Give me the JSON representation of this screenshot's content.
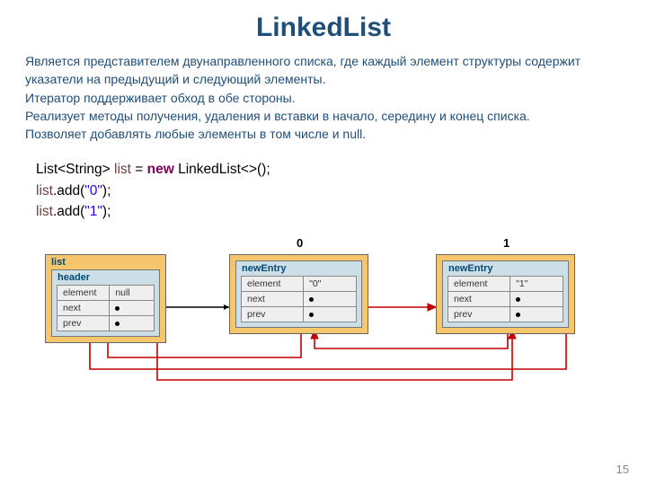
{
  "title": "LinkedList",
  "description": {
    "p1": "Является представителем двунаправленного списка, где каждый элемент структуры содержит указатели на предыдущий и следующий элементы.",
    "p2": "Итератор поддерживает обход в обе стороны.",
    "p3": "Реализует методы получения, удаления и вставки в начало, середину и конец списка.",
    "p4": "Позволяет добавлять любые элементы в том числе и null."
  },
  "code": {
    "line1": {
      "t1": "List<String> ",
      "var": "list",
      "t2": " = ",
      "kw": "new",
      "t3": " LinkedList<>();"
    },
    "line2": {
      "var": "list",
      "t1": ".add(",
      "str": "\"0\"",
      "t2": ");"
    },
    "line3": {
      "var": "list",
      "t1": ".add(",
      "str": "\"1\"",
      "t2": ");"
    }
  },
  "diagram": {
    "label0": "0",
    "label1": "1",
    "listBox": {
      "title": "list",
      "headerTitle": "header",
      "rows": {
        "element_k": "element",
        "element_v": "null",
        "next_k": "next",
        "prev_k": "prev"
      }
    },
    "node0": {
      "title": "newEntry",
      "rows": {
        "element_k": "element",
        "element_v": "\"0\"",
        "next_k": "next",
        "prev_k": "prev"
      }
    },
    "node1": {
      "title": "newEntry",
      "rows": {
        "element_k": "element",
        "element_v": "\"1\"",
        "next_k": "next",
        "prev_k": "prev"
      }
    }
  },
  "pagenum": "15"
}
